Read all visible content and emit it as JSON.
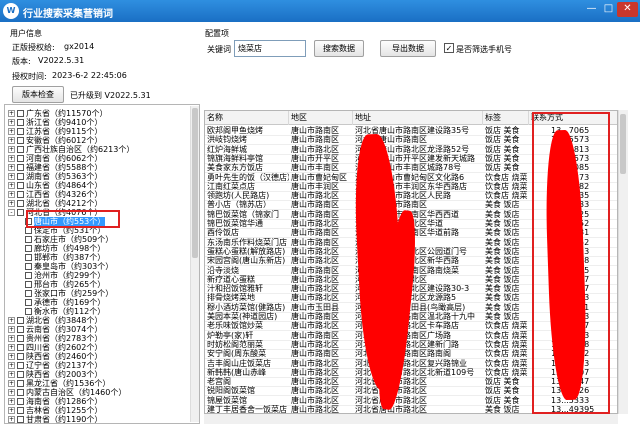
{
  "window": {
    "title": "行业搜索采集营销词",
    "icon_text": "W",
    "icon": "app-logo-icon",
    "minimize_glyph": "—",
    "maximize_glyph": "□",
    "close_glyph": "✕"
  },
  "user_info": {
    "group_title": "用户信息",
    "reg_label": "正版授权给:",
    "reg_value": "gx2014",
    "version_label": "版本:",
    "version_value": "V2022.5.31",
    "expire_label": "授权时间:",
    "expire_value": "2023-6-2 22:45:06",
    "check_button": "版本检查",
    "upgraded_text": "已升级到 V2022.5.31"
  },
  "search": {
    "group_title": "配置项",
    "keyword_label": "关键词",
    "keyword_value": "烧菜店",
    "search_button": "搜索数据",
    "export_button": "导出数据",
    "mobile_only_label": "是否筛选手机号",
    "mobile_only_checked": true,
    "checkmark": "✓"
  },
  "tree": {
    "expander": "+",
    "collapser": "-",
    "items": [
      {
        "label": "广东省（约11570个）",
        "level": 0
      },
      {
        "label": "浙江省（约9410个）",
        "level": 0
      },
      {
        "label": "江苏省（约9115个）",
        "level": 0
      },
      {
        "label": "安徽省（约6012个）",
        "level": 0
      },
      {
        "label": "广西壮族自治区（约6213个）",
        "level": 0
      },
      {
        "label": "河南省（约6062个）",
        "level": 0
      },
      {
        "label": "福建省（约5588个）",
        "level": 0
      },
      {
        "label": "湖南省（约5363个）",
        "level": 0
      },
      {
        "label": "山东省（约4864个）",
        "level": 0
      },
      {
        "label": "江西省（约4326个）",
        "level": 0
      },
      {
        "label": "湖北省（约4212个）",
        "level": 0
      },
      {
        "label": "河北省（约4076个）",
        "level": 0,
        "expanded": true
      },
      {
        "label": "唐山市（约553个）",
        "level": 1,
        "selected": true
      },
      {
        "label": "保定市（约531个）",
        "level": 1
      },
      {
        "label": "石家庄市（约509个）",
        "level": 1
      },
      {
        "label": "廊坊市（约498个）",
        "level": 1
      },
      {
        "label": "邯郸市（约387个）",
        "level": 1
      },
      {
        "label": "秦皇岛市（约303个）",
        "level": 1
      },
      {
        "label": "沧州市（约299个）",
        "level": 1
      },
      {
        "label": "邢台市（约265个）",
        "level": 1
      },
      {
        "label": "张家口市（约259个）",
        "level": 1
      },
      {
        "label": "承德市（约169个）",
        "level": 1
      },
      {
        "label": "衡水市（约112个）",
        "level": 1
      },
      {
        "label": "湖北省（约3848个）",
        "level": 0
      },
      {
        "label": "云南省（约3074个）",
        "level": 0
      },
      {
        "label": "贵州省（约2783个）",
        "level": 0
      },
      {
        "label": "四川省（约2602个）",
        "level": 0
      },
      {
        "label": "陕西省（约2460个）",
        "level": 0
      },
      {
        "label": "辽宁省（约2137个）",
        "level": 0
      },
      {
        "label": "陕西省（约2003个）",
        "level": 0
      },
      {
        "label": "黑龙江省（约1536个）",
        "level": 0
      },
      {
        "label": "内蒙古自治区（约1460个）",
        "level": 0
      },
      {
        "label": "海南省（约1286个）",
        "level": 0
      },
      {
        "label": "吉林省（约1255个）",
        "level": 0
      },
      {
        "label": "甘肃省（约1190个）",
        "level": 0
      }
    ]
  },
  "table": {
    "columns": [
      "名称",
      "地区",
      "地址",
      "标签",
      "联系方式"
    ],
    "rows": [
      {
        "name": "欧邦阁甲鱼烧烤",
        "region": "唐山市路南区",
        "addr": "河北省唐山市路南区建设路35号",
        "tag": "饭店 美食",
        "phone": "13...7065"
      },
      {
        "name": "洪岐钧烧烤",
        "region": "唐山市路南区",
        "addr": "河北省唐山市路南区",
        "tag": "饭店 美食",
        "phone": "15...5573"
      },
      {
        "name": "红炉海鲜城",
        "region": "唐山市路北区",
        "addr": "河北省唐山市路北区龙泽路52号",
        "tag": "饭店 美食",
        "phone": "13...5813"
      },
      {
        "name": "锦旗海鲜料亭馆",
        "region": "唐山市开平区",
        "addr": "河北省唐山市开平区建发新天城路",
        "tag": "饭店 美食",
        "phone": "13...3573"
      },
      {
        "name": "美食家东方饭店",
        "region": "唐山市丰南区",
        "addr": "河北省唐山市丰南区城路78号",
        "tag": "饭店 美食",
        "phone": "13...1085"
      },
      {
        "name": "勇叶先生的饭（汉德店）",
        "region": "唐山市曹妃甸区",
        "addr": "河北省唐山市曹妃甸区文化路6",
        "tag": "饮食店 烧菜",
        "phone": "18...5373"
      },
      {
        "name": "江南红菜点店",
        "region": "唐山市丰润区",
        "addr": "河北省唐山市丰润区东华西路店",
        "tag": "饮食店 烧菜",
        "phone": "15...0582"
      },
      {
        "name": "领跑坊(人民路店)",
        "region": "唐山市路北区",
        "addr": "河北省唐山市路北区人民路",
        "tag": "饮食店 烧菜",
        "phone": "13...1535"
      },
      {
        "name": "普小店（锦苏店）",
        "region": "唐山市路南区",
        "addr": "河北省唐山市路南区",
        "tag": "美食 饭店",
        "phone": "13...7733"
      },
      {
        "name": "锦巴饭菜馆（锦家门",
        "region": "唐山市路南区",
        "addr": "河北省唐山市路南区华西西道",
        "tag": "美食 饭店",
        "phone": "13...0025"
      },
      {
        "name": "锦巴饭菜馆华通",
        "region": "唐山市路北区",
        "addr": "河北省唐山市路北区华道",
        "tag": "美食 饭店",
        "phone": "13...2352"
      },
      {
        "name": "酉伶饭店",
        "region": "唐山市路南区",
        "addr": "河北省唐山市路南区华道前路",
        "tag": "美食 饭店",
        "phone": "13...5631"
      },
      {
        "name": "东汤南乐作料烧菜门店",
        "region": "唐山市路南区",
        "addr": "河北省唐山市",
        "tag": "美食 饭店",
        "phone": "15...1152"
      },
      {
        "name": "蛋糕心蛋糕(解放路店)",
        "region": "唐山市路北区",
        "addr": "河北省唐山市路北区公园道门号",
        "tag": "美食 饭店",
        "phone": "13...5803"
      },
      {
        "name": "宋园宫阁(唐山东新店)",
        "region": "唐山市路北区",
        "addr": "河北省唐山市路北区新华西路",
        "tag": "美食 饭店",
        "phone": "13...6588"
      },
      {
        "name": "沿寺淡烧",
        "region": "唐山市路南区",
        "addr": "河北省唐山市路南区路南烧菜",
        "tag": "美食 饭店",
        "phone": "15...4525"
      },
      {
        "name": "新疗道心蛋糕",
        "region": "唐山市路北区",
        "addr": "河北省唐山市路北区",
        "tag": "美食 饭店",
        "phone": "18...7537"
      },
      {
        "name": "汁和招饭馆雅轩",
        "region": "唐山市路北区",
        "addr": "河北省唐山市路北区建设路30-3",
        "tag": "美食 饭店",
        "phone": "13...5337"
      },
      {
        "name": "排骨烧烤菜地",
        "region": "唐山市路北区",
        "addr": "河北省唐山市路北区龙源路5",
        "tag": "美食 饭店",
        "phone": "13...9523"
      },
      {
        "name": "穆小酒坊菜馆(健路店)",
        "region": "唐山市玉田县",
        "addr": "河北省唐山市玉田县(鸟瞰高层)",
        "tag": "美食 饭店",
        "phone": "13...0551"
      },
      {
        "name": "美园本菜(神道园店)",
        "region": "唐山市路南区",
        "addr": "河北省唐山市路南区温北路十九中",
        "tag": "美食 饭店",
        "phone": "13...0253"
      },
      {
        "name": "老乐味饭馆炒菜",
        "region": "唐山市路北区",
        "addr": "河北省唐山市路北区卡车路店",
        "tag": "饮食店 烧菜",
        "phone": "15...0327"
      },
      {
        "name": "炉勒亭(家)轩",
        "region": "唐山市路南区",
        "addr": "河北省唐山市路南区广场路",
        "tag": "饮食店 烧菜",
        "phone": "13...3313"
      },
      {
        "name": "时妨松阁范丽菜",
        "region": "唐山市路北区",
        "addr": "河北省唐山市路北区建新门路",
        "tag": "饮食店 烧菜",
        "phone": "13...5648"
      },
      {
        "name": "安宁阁(周东酸菜",
        "region": "唐山市路南区",
        "addr": "河北省唐山市路南区路南阁",
        "tag": "饮食店 烧菜",
        "phone": "13...8052"
      },
      {
        "name": "吉丰阁山庄饭菜店",
        "region": "唐山市路北区",
        "addr": "河北省唐山市路北区复兴路锦业",
        "tag": "饮食店 烧菜",
        "phone": "13...5253"
      },
      {
        "name": "新韩韩(唐山赤峰",
        "region": "唐山市路北区",
        "addr": "河北省唐山市路北区北新道109号",
        "tag": "饮食店 烧菜",
        "phone": "13...5507"
      },
      {
        "name": "老宫阁",
        "region": "唐山市路北区",
        "addr": "河北省唐山市路北区",
        "tag": "饭店 美食",
        "phone": "13...6347"
      },
      {
        "name": "锐阳阁饭菜馆",
        "region": "唐山市路北区",
        "addr": "河北省唐山市路北区",
        "tag": "饭店 美食",
        "phone": "13...2126"
      },
      {
        "name": "锦屋饭菜馆",
        "region": "唐山市路北区",
        "addr": "河北省唐山市路北区",
        "tag": "饭店 美食",
        "phone": "13...5333"
      },
      {
        "name": "建丁丰居香舍一饭菜店",
        "region": "唐山市路北区",
        "addr": "河北省唐山市路北区",
        "tag": "美食 饭店",
        "phone": "13...49395"
      }
    ]
  }
}
